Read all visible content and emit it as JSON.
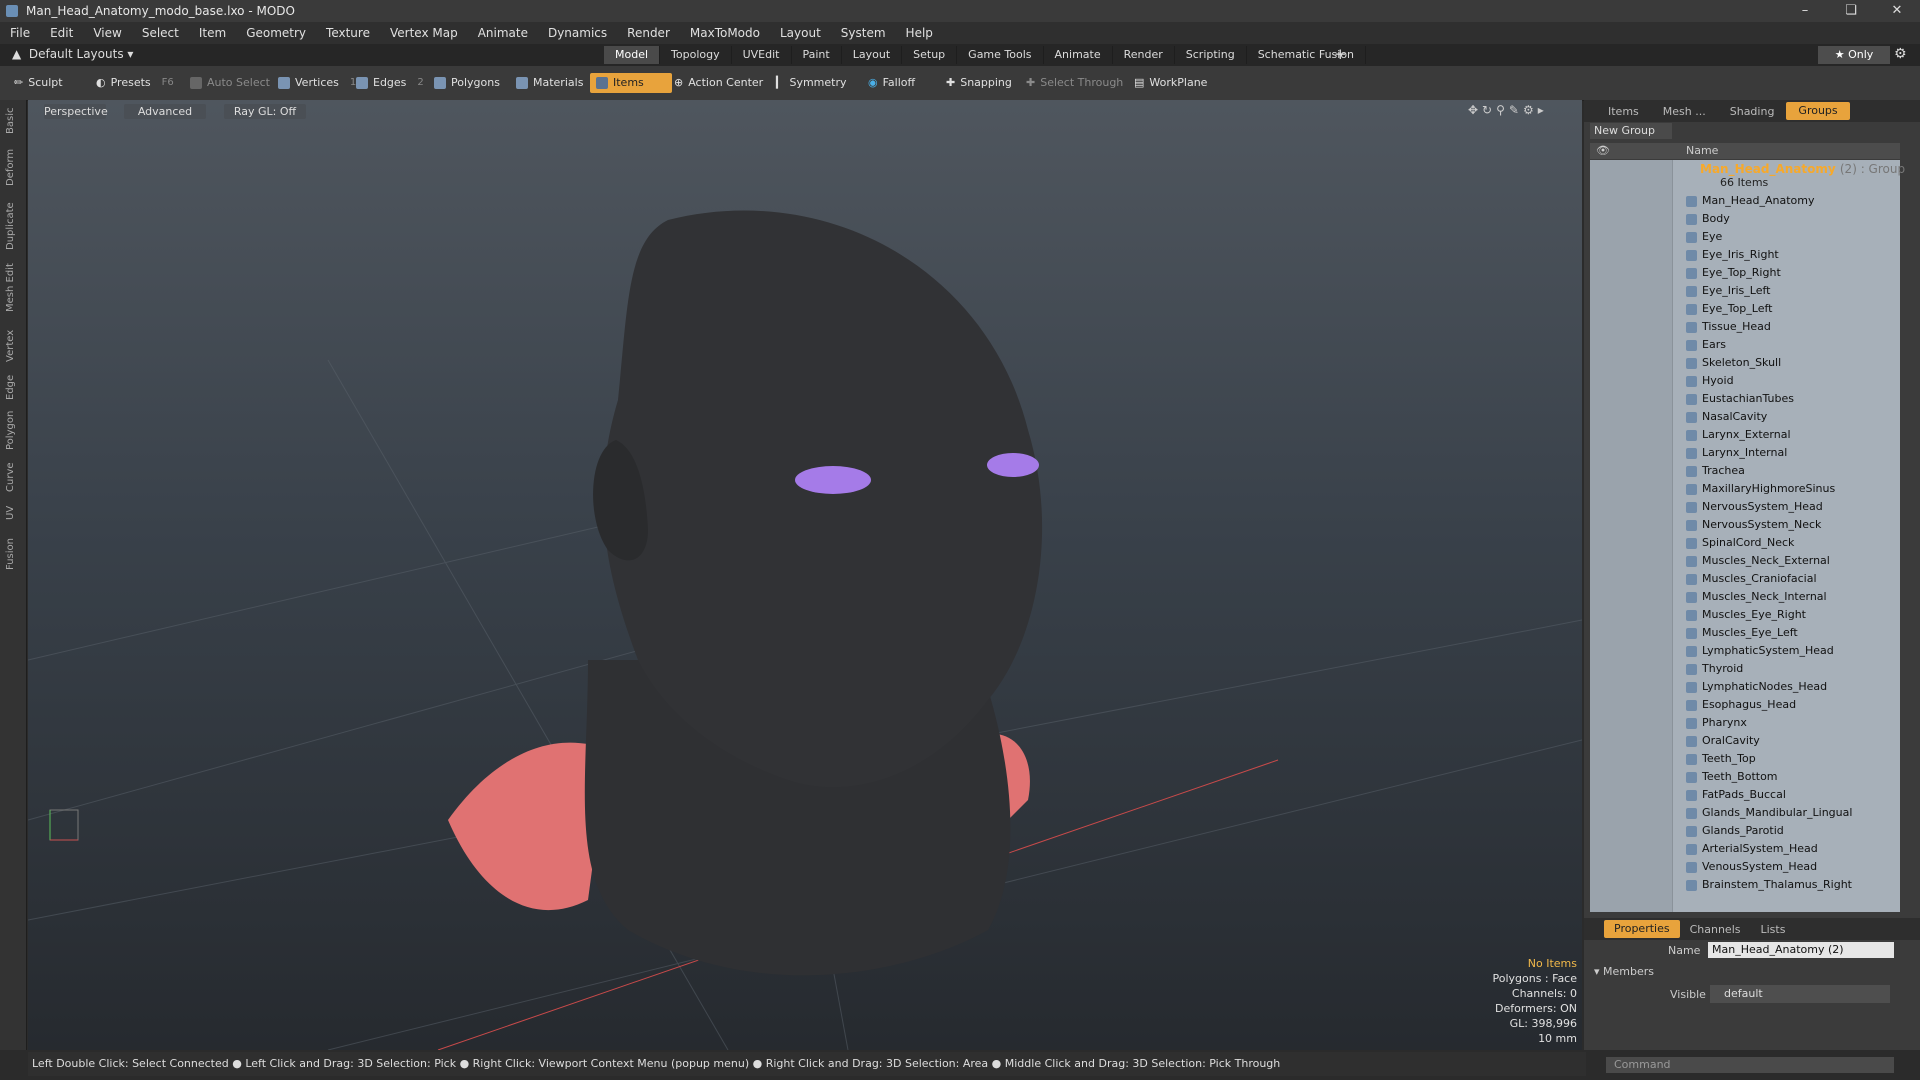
{
  "window": {
    "title": "Man_Head_Anatomy_modo_base.lxo - MODO"
  },
  "menu": [
    "File",
    "Edit",
    "View",
    "Select",
    "Item",
    "Geometry",
    "Texture",
    "Vertex Map",
    "Animate",
    "Dynamics",
    "Render",
    "MaxToModo",
    "Layout",
    "System",
    "Help"
  ],
  "layoutbar": {
    "layouts_label": "Default Layouts",
    "tabs": [
      "Model",
      "Topology",
      "UVEdit",
      "Paint",
      "Layout",
      "Setup",
      "Game Tools",
      "Animate",
      "Render",
      "Scripting",
      "Schematic Fusion"
    ],
    "plus": "+",
    "only_label": "Only"
  },
  "toolbar": {
    "sculpt": "Sculpt",
    "presets": "Presets",
    "presets_key": "F6",
    "auto_select": "Auto Select",
    "vertices": "Vertices",
    "vertices_count": "1",
    "edges": "Edges",
    "edges_count": "2",
    "polygons": "Polygons",
    "materials": "Materials",
    "items": "Items",
    "action_center": "Action Center",
    "symmetry": "Symmetry",
    "falloff": "Falloff",
    "snapping": "Snapping",
    "select_through": "Select Through",
    "workplane": "WorkPlane"
  },
  "left_strip": [
    "Basic",
    "Deform",
    "Duplicate",
    "Mesh Edit",
    "Vertex",
    "Edge",
    "Polygon",
    "Curve",
    "UV",
    "Fusion"
  ],
  "viewport": {
    "perspective": "Perspective",
    "advanced": "Advanced",
    "raygl": "Ray GL: Off",
    "info": [
      "No Items",
      "Polygons : Face",
      "Channels: 0",
      "Deformers: ON",
      "GL: 398,996",
      "10 mm"
    ]
  },
  "right_tabs": [
    "Items",
    "Mesh ...",
    "Shading",
    "Groups"
  ],
  "groups": {
    "new_group": "New Group",
    "col_name": "Name",
    "group_name": "Man_Head_Anatomy",
    "group_count": "(2) : Group",
    "items_count": "66 Items",
    "items": [
      "Man_Head_Anatomy",
      "Body",
      "Eye",
      "Eye_Iris_Right",
      "Eye_Top_Right",
      "Eye_Iris_Left",
      "Eye_Top_Left",
      "Tissue_Head",
      "Ears",
      "Skeleton_Skull",
      "Hyoid",
      "EustachianTubes",
      "NasalCavity",
      "Larynx_External",
      "Larynx_Internal",
      "Trachea",
      "MaxillaryHighmoreSinus",
      "NervousSystem_Head",
      "NervousSystem_Neck",
      "SpinalCord_Neck",
      "Muscles_Neck_External",
      "Muscles_Craniofacial",
      "Muscles_Neck_Internal",
      "Muscles_Eye_Right",
      "Muscles_Eye_Left",
      "LymphaticSystem_Head",
      "Thyroid",
      "LymphaticNodes_Head",
      "Esophagus_Head",
      "Pharynx",
      "OralCavity",
      "Teeth_Top",
      "Teeth_Bottom",
      "FatPads_Buccal",
      "Glands_Mandibular_Lingual",
      "Glands_Parotid",
      "ArterialSystem_Head",
      "VenousSystem_Head",
      "Brainstem_Thalamus_Right"
    ]
  },
  "properties": {
    "tabs": [
      "Properties",
      "Channels",
      "Lists"
    ],
    "name_label": "Name",
    "name_value": "Man_Head_Anatomy (2)",
    "members_label": "Members",
    "visible_label": "Visible",
    "visible_value": "default",
    "command_placeholder": "Command"
  },
  "statusbar": "Left Double Click: Select Connected ● Left Click and Drag: 3D Selection: Pick ● Right Click: Viewport Context Menu (popup menu) ● Right Click and Drag: 3D Selection: Area ● Middle Click and Drag: 3D Selection: Pick Through",
  "colors": {
    "accent": "#e8a33c",
    "group_title": "#f7a92b"
  }
}
